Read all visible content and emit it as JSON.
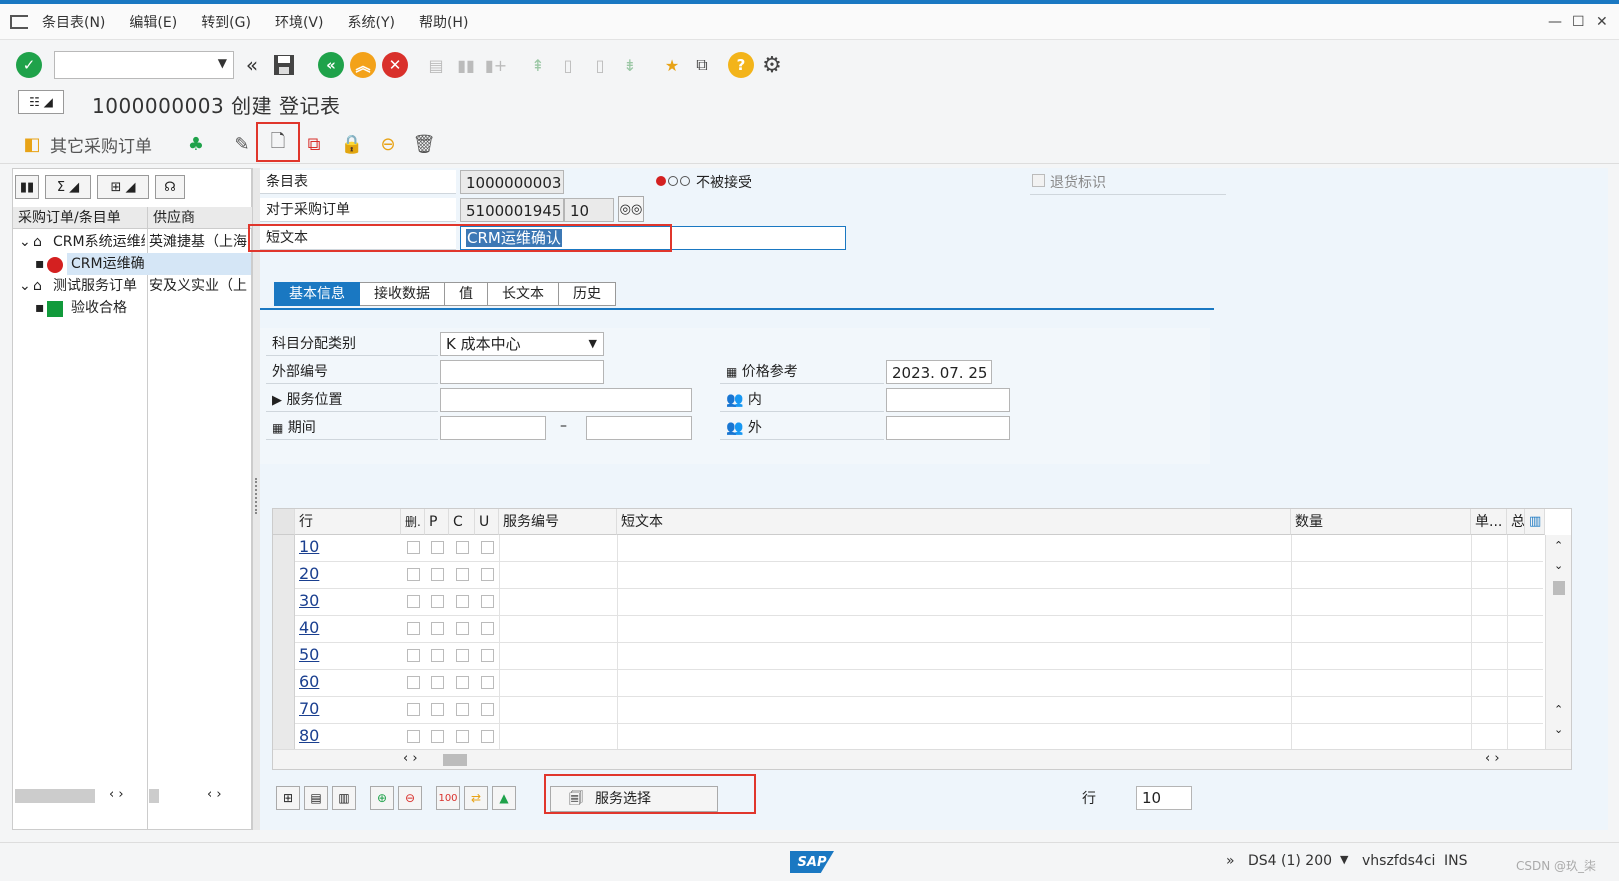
{
  "menu": {
    "items": [
      "条目表(N)",
      "编辑(E)",
      "转到(G)",
      "环境(V)",
      "系统(Y)",
      "帮助(H)"
    ]
  },
  "title": "1000000003 创建 登记表",
  "app_toolbar": {
    "other_po_label": "其它采购订单"
  },
  "tree": {
    "headers": [
      "采购订单/条目单",
      "供应商"
    ],
    "rows": [
      {
        "label": "CRM系统运维维",
        "vendor": "英滩捷基（上海",
        "level": 0,
        "icon": "expand-icon"
      },
      {
        "label": "CRM运维确",
        "vendor": "",
        "level": 1,
        "icon": "red-circle-icon",
        "status_color": "#d42020"
      },
      {
        "label": "测试服务订单",
        "vendor": "安及义实业（上",
        "level": 0,
        "icon": "expand-icon"
      },
      {
        "label": "验收合格",
        "vendor": "",
        "level": 1,
        "icon": "green-square-icon",
        "status_color": "#119a3b"
      }
    ]
  },
  "header_fields": {
    "entry_sheet_label": "条目表",
    "entry_sheet_value": "1000000003",
    "po_label": "对于采购订单",
    "po_value": "5100001945",
    "po_item": "10",
    "short_text_label": "短文本",
    "short_text_value": "CRM运维确认",
    "status_text": "不被接受",
    "return_flag_label": "退货标识"
  },
  "tabs": [
    "基本信息",
    "接收数据",
    "值",
    "长文本",
    "历史"
  ],
  "basic_info": {
    "acct_assign_label": "科目分配类别",
    "acct_assign_value": "K 成本中心",
    "ext_number_label": "外部编号",
    "service_location_label": "服务位置",
    "period_label": "期间",
    "period_sep": "–",
    "price_ref_label": "价格参考",
    "price_ref_value": "2023. 07. 25",
    "inner_label": "内",
    "outer_label": "外"
  },
  "grid": {
    "headers": [
      "行",
      "删.",
      "P",
      "C",
      "U",
      "服务编号",
      "短文本",
      "数量",
      "单...",
      "总"
    ],
    "rows": [
      "10",
      "20",
      "30",
      "40",
      "50",
      "60",
      "70",
      "80"
    ]
  },
  "footer": {
    "service_select_label": "服务选择",
    "row_label": "行",
    "row_value": "10"
  },
  "status": {
    "sap_logo": "SAP",
    "system": "DS4 (1) 200",
    "host": "vhszfds4ci",
    "mode": "INS",
    "watermark": "CSDN @玖_柒"
  },
  "colors": {
    "accent": "#1a78c2",
    "highlight": "#e0362c",
    "ok_green": "#1fa24a",
    "nav_orange": "#f3a21a",
    "cancel_red": "#d9302b"
  }
}
